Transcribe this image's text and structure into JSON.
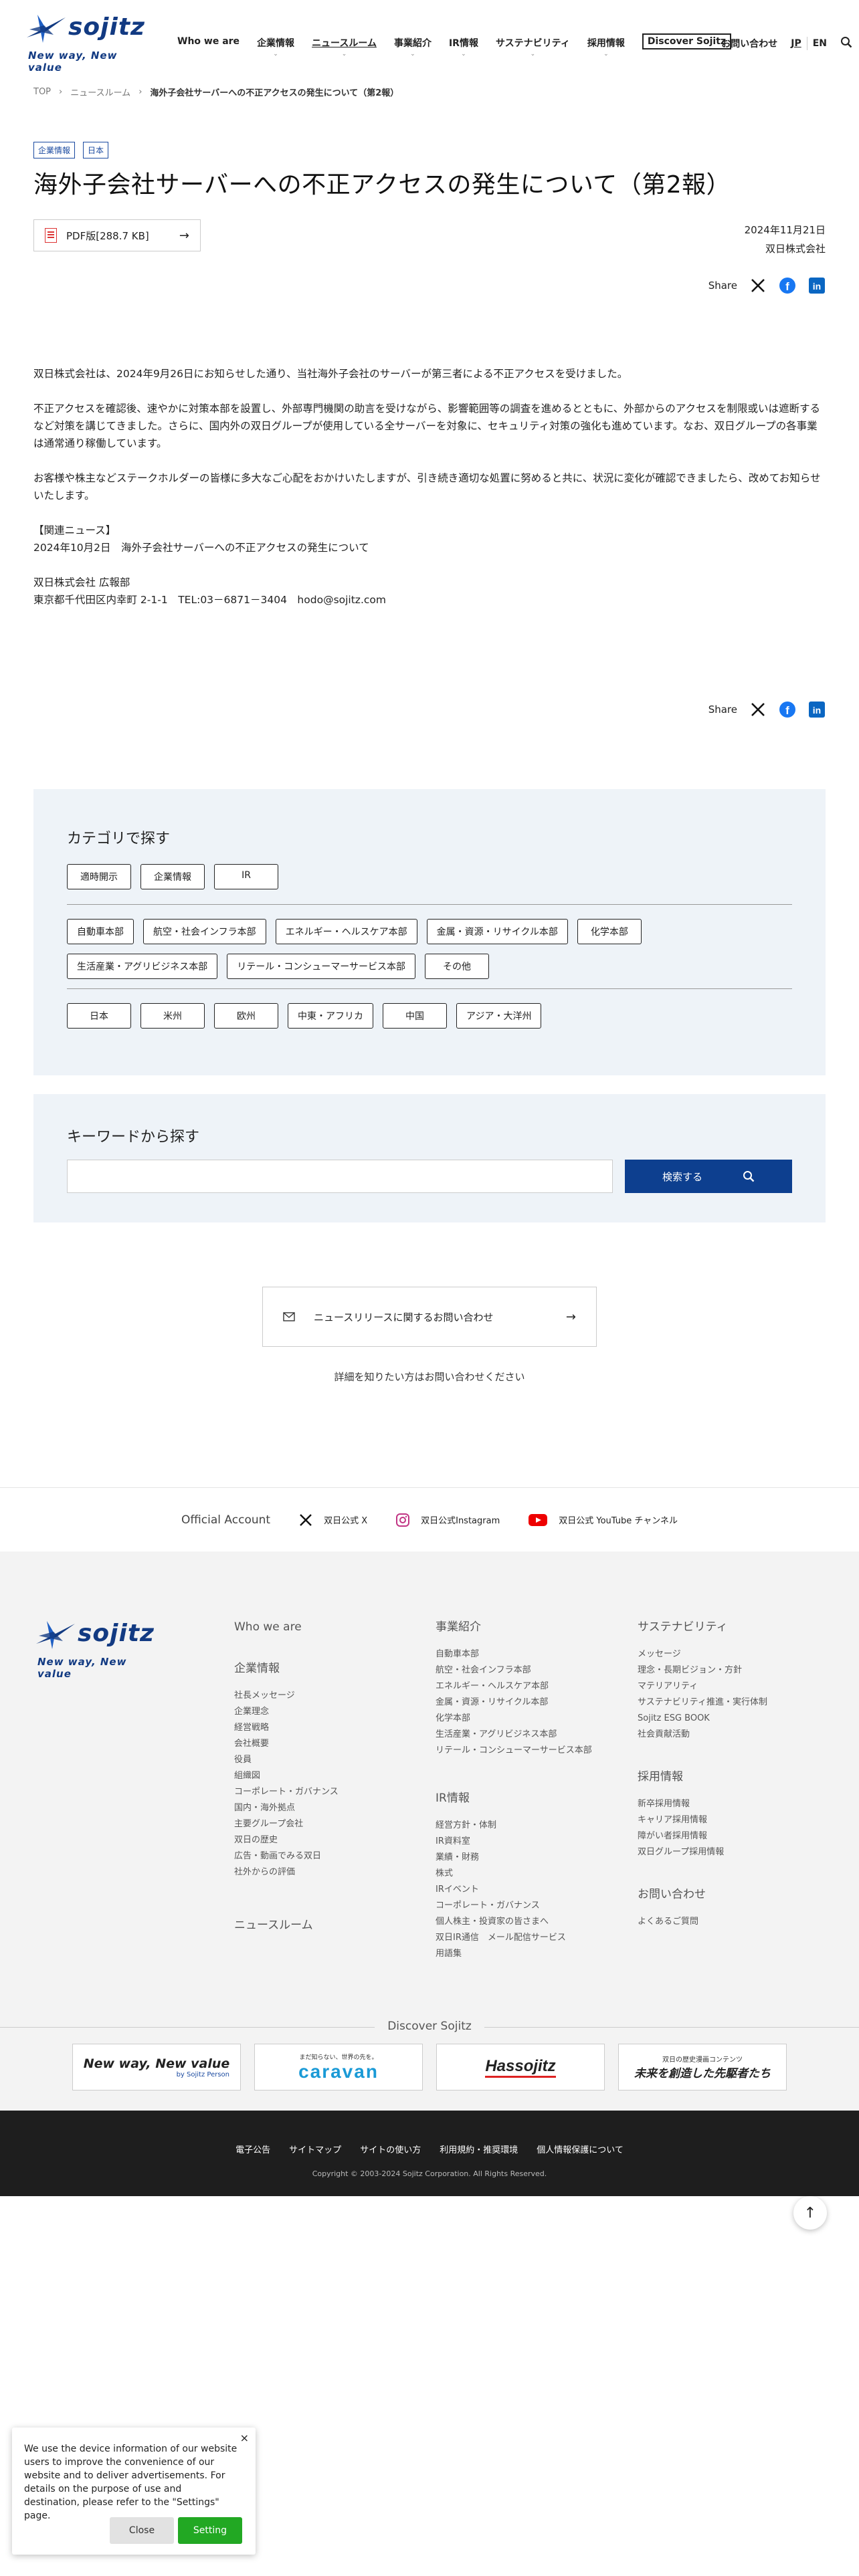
{
  "header": {
    "logo_word": "sojitz",
    "logo_tagline": "New way, New value",
    "nav": [
      {
        "label": "Who we are",
        "chevron": false
      },
      {
        "label": "企業情報",
        "chevron": true
      },
      {
        "label": "ニュースルーム",
        "chevron": true
      },
      {
        "label": "事業紹介",
        "chevron": true
      },
      {
        "label": "IR情報",
        "chevron": true
      },
      {
        "label": "サステナビリティ",
        "chevron": true
      },
      {
        "label": "採用情報",
        "chevron": true
      },
      {
        "label": "Discover Sojitz",
        "chevron": false
      }
    ],
    "contact": "お問い合わせ",
    "lang_jp": "JP",
    "lang_en": "EN"
  },
  "breadcrumb": [
    "TOP",
    "ニュースルーム",
    "海外子会社サーバーへの不正アクセスの発生について（第2報）"
  ],
  "article": {
    "tags": [
      "企業情報",
      "日本"
    ],
    "title": "海外子会社サーバーへの不正アクセスの発生について（第2報）",
    "pdf_label": "PDF版[288.7 KB]",
    "date": "2024年11月21日",
    "company": "双日株式会社",
    "share_label": "Share",
    "paragraphs": [
      "双日株式会社は、2024年9月26日にお知らせした通り、当社海外子会社のサーバーが第三者による不正アクセスを受けました。",
      "不正アクセスを確認後、速やかに対策本部を設置し、外部専門機関の助言を受けながら、影響範囲等の調査を進めるとともに、外部からのアクセスを制限或いは遮断するなど対策を講じてきました。さらに、国内外の双日グループが使用している全サーバーを対象に、セキュリティ対策の強化も進めています。なお、双日グループの各事業は通常通り稼働しています。",
      "お客様や株主などステークホルダーの皆様に多大なご心配をおかけいたしますが、引き続き適切な処置に努めると共に、状況に変化が確認できましたら、改めてお知らせいたします。"
    ],
    "related_heading": "【関連ニュース】",
    "related_item": "2024年10月2日　海外子会社サーバーへの不正アクセスの発生について",
    "contact_dept": "双日株式会社 広報部",
    "contact_addr": "東京都千代田区内幸町 2-1-1　TEL:03－6871－3404　hodo@sojitz.com"
  },
  "category": {
    "heading": "カテゴリで探す",
    "row1": [
      "適時開示",
      "企業情報",
      "IR"
    ],
    "row2": [
      "自動車本部",
      "航空・社会インフラ本部",
      "エネルギー・ヘルスケア本部",
      "金属・資源・リサイクル本部",
      "化学本部",
      "生活産業・アグリビジネス本部",
      "リテール・コンシューマーサービス本部",
      "その他"
    ],
    "row3": [
      "日本",
      "米州",
      "欧州",
      "中東・アフリカ",
      "中国",
      "アジア・大洋州"
    ]
  },
  "keyword": {
    "heading": "キーワードから探す",
    "placeholder": "",
    "button": "検索する"
  },
  "contact_box": {
    "label": "ニュースリリースに関するお問い合わせ",
    "sub": "詳細を知りたい方はお問い合わせください"
  },
  "official": {
    "label": "Official Account",
    "x": "双日公式 X",
    "instagram": "双日公式Instagram",
    "youtube": "双日公式 YouTube チャンネル"
  },
  "footer": {
    "who": "Who we are",
    "corp_heading": "企業情報",
    "corp_items": [
      "社長メッセージ",
      "企業理念",
      "経営戦略",
      "会社概要",
      "役員",
      "組織図",
      "コーポレート・ガバナンス",
      "国内・海外拠点",
      "主要グループ会社",
      "双日の歴史",
      "広告・動画でみる双日",
      "社外からの評価"
    ],
    "news": "ニュースルーム",
    "biz_heading": "事業紹介",
    "biz_items": [
      "自動車本部",
      "航空・社会インフラ本部",
      "エネルギー・ヘルスケア本部",
      "金属・資源・リサイクル本部",
      "化学本部",
      "生活産業・アグリビジネス本部",
      "リテール・コンシューマーサービス本部"
    ],
    "ir_heading": "IR情報",
    "ir_items": [
      "経営方針・体制",
      "IR資料室",
      "業績・財務",
      "株式",
      "IRイベント",
      "コーポレート・ガバナンス",
      "個人株主・投資家の皆さまへ",
      "双日IR通信　メール配信サービス",
      "用語集"
    ],
    "sus_heading": "サステナビリティ",
    "sus_items": [
      "メッセージ",
      "理念・長期ビジョン・方針",
      "マテリアリティ",
      "サステナビリティ推進・実行体制",
      "Sojitz ESG BOOK",
      "社会貢献活動"
    ],
    "rec_heading": "採用情報",
    "rec_items": [
      "新卒採用情報",
      "キャリア採用情報",
      "障がい者採用情報",
      "双日グループ採用情報"
    ],
    "inq_heading": "お問い合わせ",
    "inq_items": [
      "よくあるご質問"
    ]
  },
  "discover": {
    "title": "Discover Sojitz",
    "b1_main": "New way, New value",
    "b1_sub": "by Sojitz Person",
    "b2_sub": "まだ知らない、世界の先を。",
    "b2_main": "caravan",
    "b3_main": "Hassojitz",
    "b4_sub": "双日の歴史漫画コンテンツ",
    "b4_main": "未来を創造した先駆者たち"
  },
  "bottom": {
    "links": [
      "電子公告",
      "サイトマップ",
      "サイトの使い方",
      "利用規約・推奨環境",
      "個人情報保護について"
    ],
    "copyright": "Copyright © 2003-2024 Sojitz Corporation. All Rights Reserved."
  },
  "cookie": {
    "text": "We use the device information of our website users to improve the convenience of our website and to deliver advertisements. For details on the purpose of use and destination, please refer to the \"Settings\" page.",
    "close": "Close",
    "settings": "Setting"
  },
  "colors": {
    "brand": "#123a82",
    "button": "#0d3f8f",
    "panel": "#eef3f8",
    "cookie_green": "#22a823"
  }
}
